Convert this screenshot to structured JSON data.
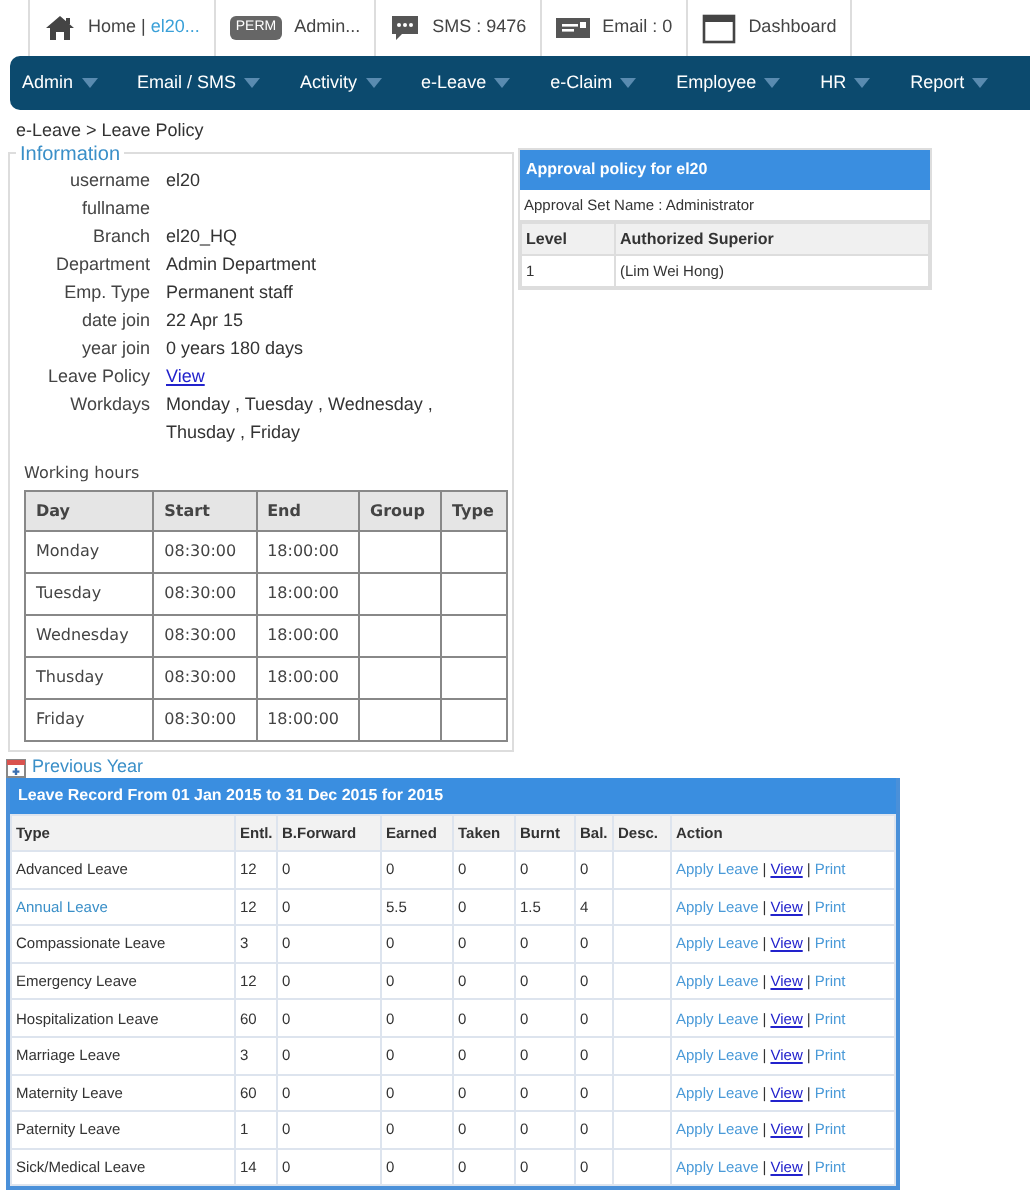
{
  "topbar": {
    "items": [
      {
        "kind": "home",
        "label": "Home | ",
        "user": "el20..."
      },
      {
        "kind": "perm",
        "badge": "PERM",
        "label": "Admin..."
      },
      {
        "kind": "sms",
        "label": "SMS : 9476"
      },
      {
        "kind": "email",
        "label": "Email : 0"
      },
      {
        "kind": "dashboard",
        "label": "Dashboard"
      }
    ]
  },
  "menu": [
    "Admin",
    "Email / SMS",
    "Activity",
    "e-Leave",
    "e-Claim",
    "Employee",
    "HR",
    "Report"
  ],
  "breadcrumb": "e-Leave > Leave Policy",
  "information": {
    "legend": "Information",
    "fields": [
      {
        "label": "username",
        "value": "el20"
      },
      {
        "label": "fullname"
      },
      {
        "label": "Branch",
        "value": "el20_HQ"
      },
      {
        "label": "Department",
        "value": "Admin Department"
      },
      {
        "label": "Emp. Type",
        "value": "Permanent staff"
      },
      {
        "label": "date join",
        "value": "22 Apr 15"
      },
      {
        "label": "year join",
        "value": "0 years 180 days"
      },
      {
        "label": "Leave Policy",
        "value": "View",
        "kind": "link"
      },
      {
        "label": "Workdays",
        "value": "Monday , Tuesday , Wednesday , Thusday , Friday"
      }
    ],
    "working_hours": {
      "title": "Working hours",
      "columns": [
        "Day",
        "Start",
        "End",
        "Group",
        "Type"
      ],
      "rows": [
        [
          "Monday",
          "08:30:00",
          "18:00:00"
        ],
        [
          "Tuesday",
          "08:30:00",
          "18:00:00"
        ],
        [
          "Wednesday",
          "08:30:00",
          "18:00:00"
        ],
        [
          "Thusday",
          "08:30:00",
          "18:00:00"
        ],
        [
          "Friday",
          "08:30:00",
          "18:00:00"
        ]
      ]
    }
  },
  "approval": {
    "title": "Approval policy for el20",
    "set_name": "Approval Set Name : Administrator",
    "columns": [
      "Level",
      "Authorized Superior"
    ],
    "rows": [
      [
        "1",
        "(Lim Wei Hong)"
      ]
    ]
  },
  "previous_year": "Previous Year",
  "leave_record": {
    "title": "Leave Record From 01 Jan 2015 to 31 Dec 2015 for 2015",
    "columns": [
      "Type",
      "Entl.",
      "B.Forward",
      "Earned",
      "Taken",
      "Burnt",
      "Bal.",
      "Desc.",
      "Action"
    ],
    "rows": [
      {
        "type": "Advanced Leave",
        "linked": false,
        "values": [
          "12",
          "0",
          "0",
          "0",
          "0",
          "0"
        ],
        "actions": {
          "apply": "Apply Leave",
          "sep1": "|",
          "view": "View",
          "sep2": "|",
          "print": "Print"
        }
      },
      {
        "type": "Annual Leave",
        "linked": true,
        "values": [
          "12",
          "0",
          "5.5",
          "0",
          "1.5",
          "4"
        ],
        "actions": {
          "apply": "Apply Leave",
          "sep1": "|",
          "view": "View",
          "sep2": "|",
          "print": "Print"
        }
      },
      {
        "type": "Compassionate Leave",
        "linked": false,
        "values": [
          "3",
          "0",
          "0",
          "0",
          "0",
          "0"
        ],
        "actions": {
          "apply": "Apply Leave",
          "sep1": "|",
          "view": "View",
          "sep2": "|",
          "print": "Print"
        }
      },
      {
        "type": "Emergency Leave",
        "linked": false,
        "values": [
          "12",
          "0",
          "0",
          "0",
          "0",
          "0"
        ],
        "actions": {
          "apply": "Apply Leave",
          "sep1": "|",
          "view": "View",
          "sep2": "|",
          "print": "Print"
        }
      },
      {
        "type": "Hospitalization Leave",
        "linked": false,
        "values": [
          "60",
          "0",
          "0",
          "0",
          "0",
          "0"
        ],
        "actions": {
          "apply": "Apply Leave",
          "sep1": "|",
          "view": "View",
          "sep2": "|",
          "print": "Print"
        }
      },
      {
        "type": "Marriage Leave",
        "linked": false,
        "values": [
          "3",
          "0",
          "0",
          "0",
          "0",
          "0"
        ],
        "actions": {
          "apply": "Apply Leave",
          "sep1": "|",
          "view": "View",
          "sep2": "|",
          "print": "Print"
        }
      },
      {
        "type": "Maternity Leave",
        "linked": false,
        "values": [
          "60",
          "0",
          "0",
          "0",
          "0",
          "0"
        ],
        "actions": {
          "apply": "Apply Leave",
          "sep1": "|",
          "view": "View",
          "sep2": "|",
          "print": "Print"
        }
      },
      {
        "type": "Paternity Leave",
        "linked": false,
        "values": [
          "1",
          "0",
          "0",
          "0",
          "0",
          "0"
        ],
        "actions": {
          "apply": "Apply Leave",
          "sep1": "|",
          "view": "View",
          "sep2": "|",
          "print": "Print"
        }
      },
      {
        "type": "Sick/Medical Leave",
        "linked": false,
        "values": [
          "14",
          "0",
          "0",
          "0",
          "0",
          "0"
        ],
        "actions": {
          "apply": "Apply Leave",
          "sep1": "|",
          "view": "View",
          "sep2": "|",
          "print": "Print"
        }
      }
    ]
  }
}
